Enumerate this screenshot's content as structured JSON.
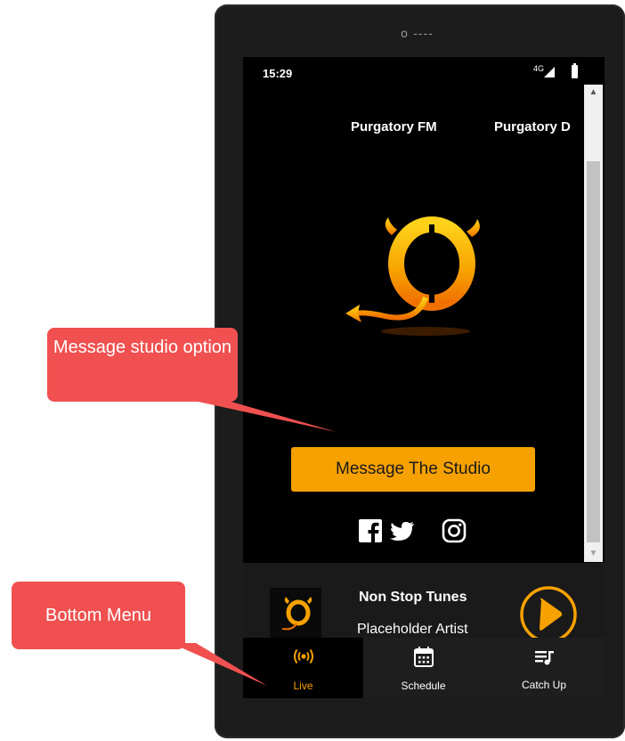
{
  "device": {
    "speaker_text": "o ----"
  },
  "status_bar": {
    "time": "15:29",
    "network": "4G"
  },
  "stations": [
    "Purgatory FM",
    "Purgatory D"
  ],
  "message_button": {
    "label": "Message The Studio"
  },
  "social": [
    "facebook-icon",
    "twitter-icon",
    "instagram-icon"
  ],
  "now_playing": {
    "title": "Non Stop Tunes",
    "artist": "Placeholder Artist"
  },
  "bottom_nav": [
    {
      "label": "Live",
      "icon": "live-broadcast-icon",
      "active": true
    },
    {
      "label": "Schedule",
      "icon": "calendar-icon",
      "active": false
    },
    {
      "label": "Catch Up",
      "icon": "playlist-icon",
      "active": false
    }
  ],
  "annotations": [
    {
      "text": "Message studio option"
    },
    {
      "text": "Bottom Menu"
    }
  ],
  "colors": {
    "accent": "#f7a100",
    "callout": "#f05050",
    "screen_bg": "#000000",
    "device_body": "#1c1c1c"
  }
}
